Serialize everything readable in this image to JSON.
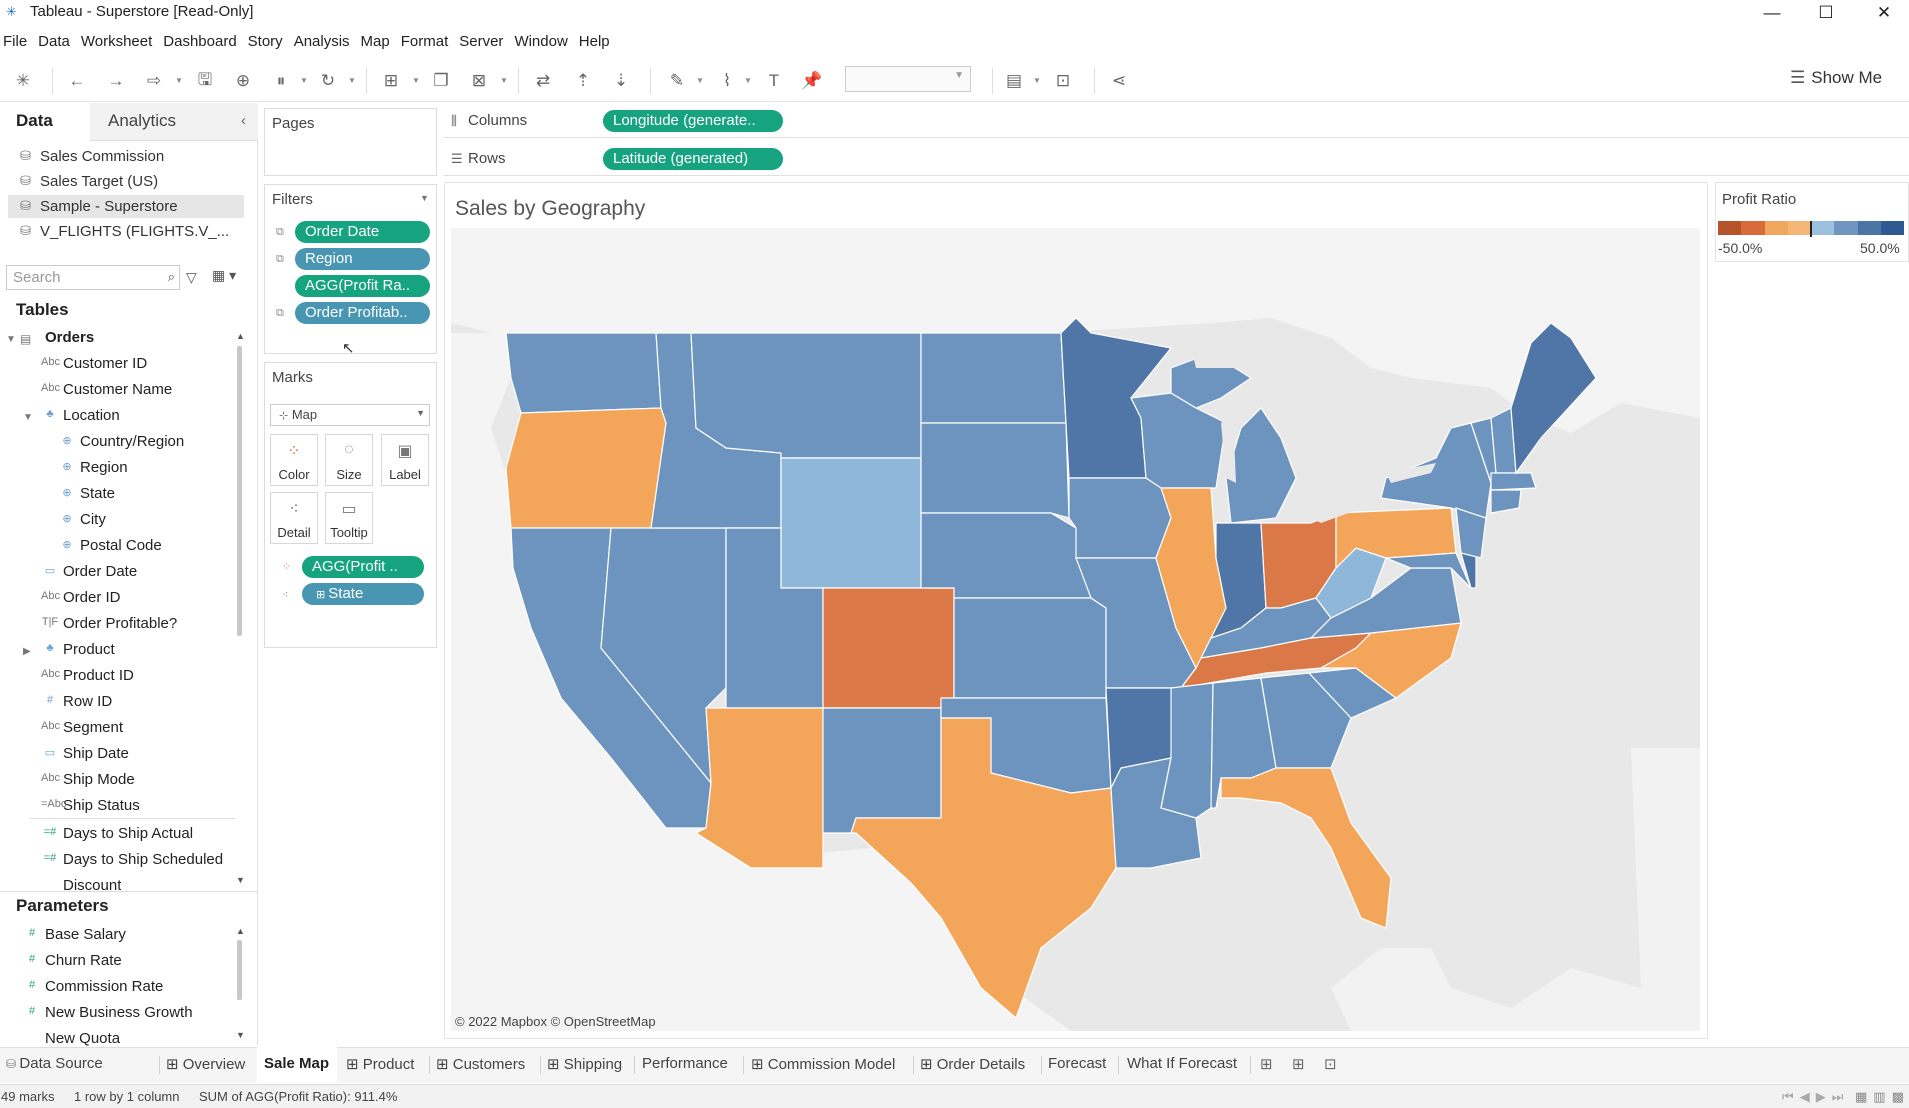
{
  "window": {
    "title": "Tableau - Superstore [Read-Only]",
    "minimize": "—",
    "maximize": "☐",
    "close": "✕"
  },
  "menu": [
    "File",
    "Data",
    "Worksheet",
    "Dashboard",
    "Story",
    "Analysis",
    "Map",
    "Format",
    "Server",
    "Window",
    "Help"
  ],
  "toolbar": {
    "show_me": "Show Me"
  },
  "data_pane": {
    "tab_data": "Data",
    "tab_analytics": "Analytics",
    "data_sources": [
      {
        "label": "Sales Commission",
        "selected": false
      },
      {
        "label": "Sales Target (US)",
        "selected": false
      },
      {
        "label": "Sample - Superstore",
        "selected": true
      },
      {
        "label": "V_FLIGHTS (FLIGHTS.V_...",
        "selected": false
      }
    ],
    "search_placeholder": "Search",
    "tables_heading": "Tables",
    "table_name": "Orders",
    "fields": [
      {
        "label": "Customer ID",
        "icon": "Abc"
      },
      {
        "label": "Customer Name",
        "icon": "Abc"
      },
      {
        "label": "Location",
        "icon": "hierarchy"
      },
      {
        "label": "Country/Region",
        "icon": "globe"
      },
      {
        "label": "Region",
        "icon": "globe"
      },
      {
        "label": "State",
        "icon": "globe"
      },
      {
        "label": "City",
        "icon": "globe"
      },
      {
        "label": "Postal Code",
        "icon": "globe"
      },
      {
        "label": "Order Date",
        "icon": "calendar"
      },
      {
        "label": "Order ID",
        "icon": "Abc"
      },
      {
        "label": "Order Profitable?",
        "icon": "T|F"
      },
      {
        "label": "Product",
        "icon": "hierarchy"
      },
      {
        "label": "Product ID",
        "icon": "Abc"
      },
      {
        "label": "Row ID",
        "icon": "#"
      },
      {
        "label": "Segment",
        "icon": "Abc"
      },
      {
        "label": "Ship Date",
        "icon": "calendar"
      },
      {
        "label": "Ship Mode",
        "icon": "Abc"
      },
      {
        "label": "Ship Status",
        "icon": "Abc"
      },
      {
        "label": "Days to Ship Actual",
        "icon": "#"
      },
      {
        "label": "Days to Ship Scheduled",
        "icon": "#"
      },
      {
        "label": "Discount",
        "icon": "#"
      }
    ],
    "parameters_heading": "Parameters",
    "parameters": [
      "Base Salary",
      "Churn Rate",
      "Commission Rate",
      "New Business Growth",
      "New Quota"
    ]
  },
  "cards": {
    "pages": "Pages",
    "filters": "Filters",
    "filter_pills": [
      "Order Date",
      "Region",
      "AGG(Profit Ra..",
      "Order Profitab.."
    ],
    "marks": "Marks",
    "mark_type": "Map",
    "mark_buttons": [
      "Color",
      "Size",
      "Label",
      "Detail",
      "Tooltip"
    ],
    "mark_pills": [
      "AGG(Profit ..",
      "State"
    ]
  },
  "shelves": {
    "columns_label": "Columns",
    "columns_pill": "Longitude (generate..",
    "rows_label": "Rows",
    "rows_pill": "Latitude (generated)"
  },
  "sheet": {
    "title": "Sales by Geography",
    "attribution": "© 2022 Mapbox © OpenStreetMap"
  },
  "legend": {
    "title": "Profit Ratio",
    "min": "-50.0%",
    "max": "50.0%",
    "colors": [
      "#b5542a",
      "#d96b3b",
      "#f0a65f",
      "#f4b776",
      "#9cc1df",
      "#6f96c0",
      "#4c75a6",
      "#2f5992"
    ]
  },
  "map_colors": {
    "blue": "#6d94be",
    "dark_blue": "#4f76a6",
    "light_blue": "#8fb7da",
    "orange": "#f3a55a",
    "dark_orange": "#db7847",
    "land": "#f4f4f4",
    "water": "#e6e6e6"
  },
  "tabs": {
    "data_source": "Data Source",
    "sheets": [
      {
        "label": "Overview",
        "icon": "⊞"
      },
      {
        "label": "Sale Map",
        "icon": ""
      },
      {
        "label": "Product",
        "icon": "⊞"
      },
      {
        "label": "Customers",
        "icon": "⊞"
      },
      {
        "label": "Shipping",
        "icon": "⊞"
      },
      {
        "label": "Performance",
        "icon": ""
      },
      {
        "label": "Commission Model",
        "icon": "⊞"
      },
      {
        "label": "Order Details",
        "icon": "⊞"
      },
      {
        "label": "Forecast",
        "icon": ""
      },
      {
        "label": "What If Forecast",
        "icon": ""
      }
    ],
    "active": "Sale Map"
  },
  "status": {
    "marks": "49 marks",
    "dims": "1 row by 1 column",
    "sum": "SUM of AGG(Profit Ratio): 911.4%"
  }
}
